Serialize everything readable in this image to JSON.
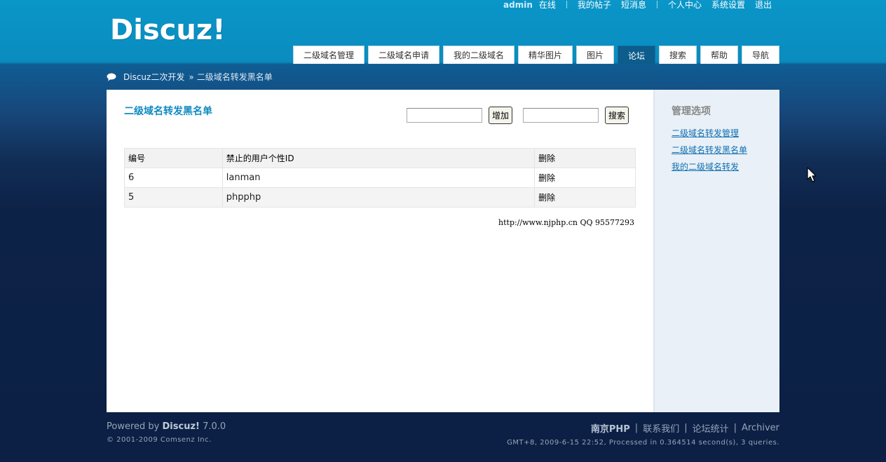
{
  "header": {
    "logo": "Discuz!",
    "topmenu": {
      "username": "admin",
      "online": "在线",
      "my_posts": "我的帖子",
      "messages": "短消息",
      "profile": "个人中心",
      "settings": "系统设置",
      "logout": "退出"
    },
    "tabs": [
      {
        "label": "二级域名管理",
        "active": false
      },
      {
        "label": "二级域名申请",
        "active": false
      },
      {
        "label": "我的二级域名",
        "active": false
      },
      {
        "label": "精华图片",
        "active": false
      },
      {
        "label": "图片",
        "active": false
      },
      {
        "label": "论坛",
        "active": true
      },
      {
        "label": "搜索",
        "active": false
      },
      {
        "label": "帮助",
        "active": false
      },
      {
        "label": "导航",
        "active": false
      }
    ]
  },
  "breadcrumb": {
    "root": "Discuz二次开发",
    "separator": "»",
    "current": "二级域名转发黑名单"
  },
  "main": {
    "title": "二级域名转发黑名单",
    "add_input": {
      "value": "",
      "placeholder": ""
    },
    "add_button": "增加",
    "search_input": {
      "value": "",
      "placeholder": ""
    },
    "search_button": "搜索",
    "table": {
      "headers": [
        "编号",
        "禁止的用户个性ID",
        "删除"
      ],
      "rows": [
        {
          "id": "6",
          "name": "lanman",
          "action": "删除"
        },
        {
          "id": "5",
          "name": "phpphp",
          "action": "删除"
        }
      ]
    },
    "credit": "http://www.njphp.cn QQ 95577293"
  },
  "sidebar": {
    "title": "管理选项",
    "links": [
      "二级域名转发管理",
      "二级域名转发黑名单",
      "我的二级域名转发"
    ]
  },
  "footer": {
    "powered_prefix": "Powered by",
    "product": "Discuz!",
    "version": "7.0.0",
    "copyright": "© 2001-2009 Comsenz Inc.",
    "links": {
      "brand": "南京PHP",
      "contact": "联系我们",
      "stats": "论坛统计",
      "archiver": "Archiver"
    },
    "debug": "GMT+8, 2009-6-15 22:52, Processed in 0.364514 second(s), 3 queries."
  },
  "colors": {
    "header_bg": "#0a96c8",
    "active_tab": "#0c5c8c",
    "title_blue": "#0f8ac0",
    "link_blue": "#0f6fb0",
    "sidebar_bg": "#e9f0f7",
    "page_dark": "#0c2045"
  },
  "icons": [
    "speech-bubble-icon",
    "mouse-cursor-icon"
  ]
}
